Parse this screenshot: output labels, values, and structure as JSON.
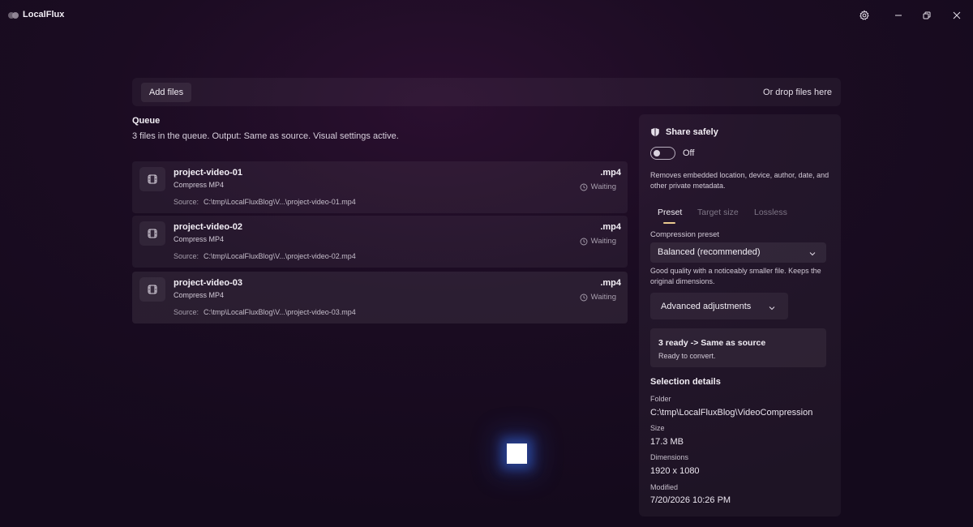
{
  "app": {
    "title": "LocalFlux"
  },
  "toolbar": {
    "add_files": "Add files",
    "drop_hint": "Or drop files here"
  },
  "queue": {
    "title": "Queue",
    "subtitle": "3 files in the queue. Output: Same as source. Visual settings active.",
    "source_label": "Source:",
    "items": [
      {
        "name": "project-video-01",
        "action": "Compress MP4",
        "source": "C:\\tmp\\LocalFluxBlog\\V...\\project-video-01.mp4",
        "ext": ".mp4",
        "status": "Waiting"
      },
      {
        "name": "project-video-02",
        "action": "Compress MP4",
        "source": "C:\\tmp\\LocalFluxBlog\\V...\\project-video-02.mp4",
        "ext": ".mp4",
        "status": "Waiting"
      },
      {
        "name": "project-video-03",
        "action": "Compress MP4",
        "source": "C:\\tmp\\LocalFluxBlog\\V...\\project-video-03.mp4",
        "ext": ".mp4",
        "status": "Waiting"
      }
    ]
  },
  "share": {
    "title": "Share safely",
    "toggle_state": "Off",
    "description": "Removes embedded location, device, author, date, and other private metadata."
  },
  "tabs": {
    "preset": "Preset",
    "target": "Target size",
    "lossless": "Lossless"
  },
  "compression": {
    "label": "Compression preset",
    "value": "Balanced (recommended)",
    "description": "Good quality with a noticeably smaller file. Keeps the original dimensions."
  },
  "advanced": {
    "label": "Advanced adjustments"
  },
  "ready": {
    "title": "3 ready -> Same as source",
    "subtitle": "Ready to convert."
  },
  "details": {
    "title": "Selection details",
    "folder_label": "Folder",
    "folder_value": "C:\\tmp\\LocalFluxBlog\\VideoCompression",
    "size_label": "Size",
    "size_value": "17.3 MB",
    "dimensions_label": "Dimensions",
    "dimensions_value": "1920 x 1080",
    "modified_label": "Modified",
    "modified_value": "7/20/2026 10:26 PM"
  },
  "icons": {
    "settings": "gear-icon",
    "minimize": "minimize-icon",
    "restore": "restore-icon",
    "close": "close-icon",
    "file": "film-frame-icon",
    "status": "clock-icon",
    "share": "shield-icon",
    "dropdown": "chevron-down-icon"
  },
  "colors": {
    "tab_accent": "#e9c98f",
    "background": "#1b0c22"
  }
}
